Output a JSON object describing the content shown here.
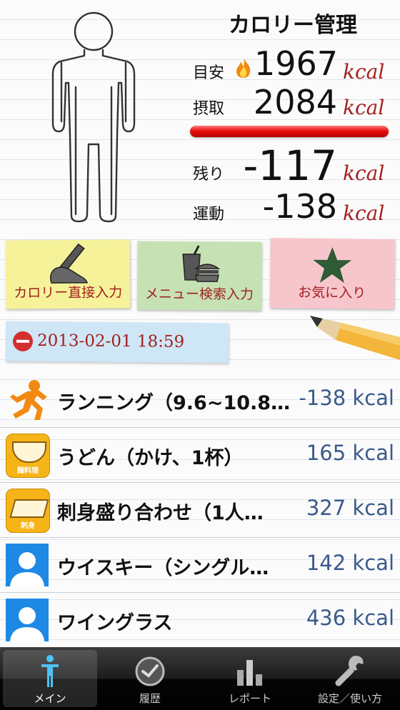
{
  "header": {
    "title": "カロリー管理",
    "target_label": "目安",
    "target_value": "1967",
    "intake_label": "摂取",
    "intake_value": "2084",
    "remaining_label": "残り",
    "remaining_value": "-117",
    "exercise_label": "運動",
    "exercise_value": "-138",
    "unit": "kcal"
  },
  "shortcuts": {
    "direct_input": "カロリー直接入力",
    "menu_search": "メニュー検索入力",
    "favorites": "お気に入り"
  },
  "date_time": "2013-02-01 18:59",
  "entries": [
    {
      "name": "ランニング（9.6~10.8…",
      "kcal": "-138 kcal",
      "icon": "running-icon"
    },
    {
      "name": "うどん（かけ、1杯）",
      "kcal": "165 kcal",
      "icon": "noodle-dish-icon",
      "icon_text": "麺料理"
    },
    {
      "name": "刺身盛り合わせ（1人…",
      "kcal": "327 kcal",
      "icon": "sashimi-icon",
      "icon_text": "刺身"
    },
    {
      "name": "ウイスキー（シングル…",
      "kcal": "142 kcal",
      "icon": "user-silhouette-icon"
    },
    {
      "name": "ワイングラス",
      "kcal": "436 kcal",
      "icon": "user-silhouette-icon"
    }
  ],
  "tabs": [
    {
      "label": "メイン",
      "icon": "person-icon",
      "active": true
    },
    {
      "label": "履歴",
      "icon": "clock-icon",
      "active": false
    },
    {
      "label": "レポート",
      "icon": "bar-chart-icon",
      "active": false
    },
    {
      "label": "設定／使い方",
      "icon": "wrench-icon",
      "active": false
    }
  ],
  "colors": {
    "kcal_red": "#a32020",
    "list_kcal_blue": "#3b5a8a",
    "note_yellow": "#f6f29a",
    "note_green": "#c6e2b4",
    "note_pink": "#f7c6cc"
  }
}
